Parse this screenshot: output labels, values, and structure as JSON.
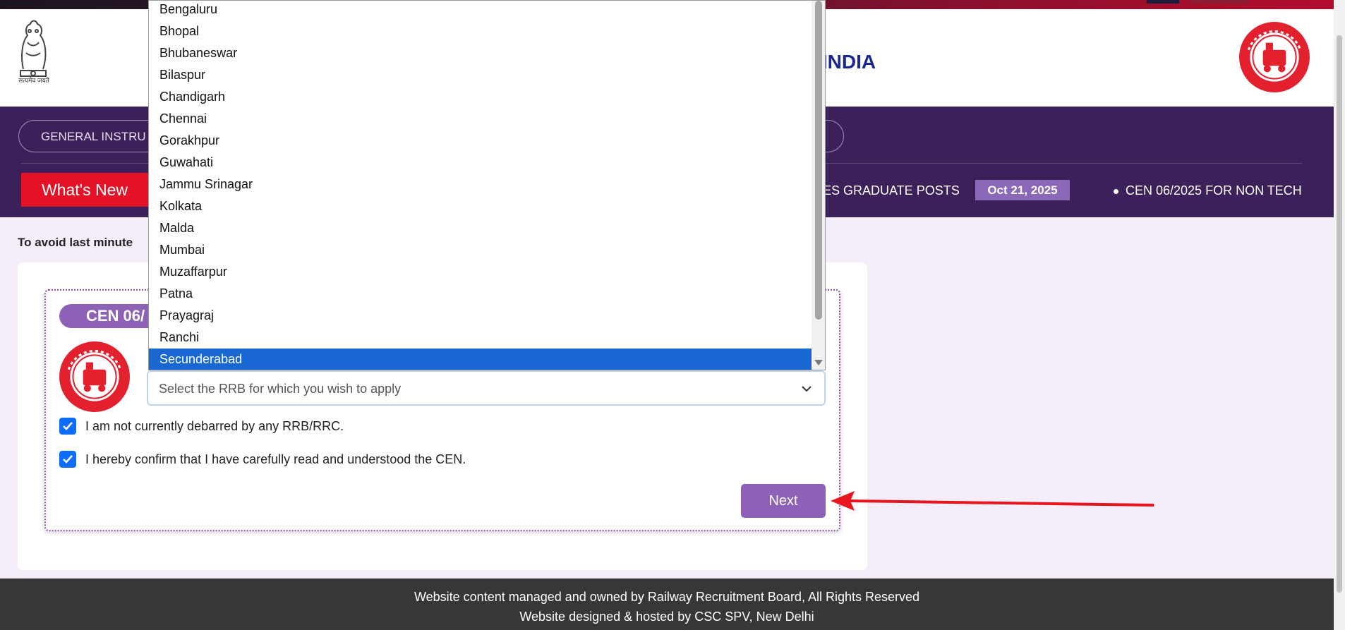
{
  "header": {
    "title": "F INDIA",
    "emblem_caption": "सत्यमेव जयते"
  },
  "nav": {
    "first_item": "GENERAL INSTRU"
  },
  "ticker": {
    "label": "What's New",
    "item1_text": "RIES GRADUATE POSTS",
    "item1_date": "Oct 21, 2025",
    "item2_text": "CEN 06/2025 FOR NON TECH"
  },
  "notice": "To avoid last minute",
  "form": {
    "badge": "CEN 06/",
    "select_placeholder": "Select the RRB for which you wish to apply",
    "checkbox1_label": "I am not currently debarred by any RRB/RRC.",
    "checkbox2_label": "I hereby confirm that I have carefully read and understood the CEN.",
    "checkbox1_checked": true,
    "checkbox2_checked": true,
    "next_label": "Next"
  },
  "dropdown": {
    "options": [
      "Bengaluru",
      "Bhopal",
      "Bhubaneswar",
      "Bilaspur",
      "Chandigarh",
      "Chennai",
      "Gorakhpur",
      "Guwahati",
      "Jammu Srinagar",
      "Kolkata",
      "Malda",
      "Mumbai",
      "Muzaffarpur",
      "Patna",
      "Prayagraj",
      "Ranchi",
      "Secunderabad"
    ],
    "highlighted": "Secunderabad"
  },
  "footer": {
    "line1": "Website content managed and owned by Railway Recruitment Board, All Rights Reserved",
    "line2": "Website designed & hosted by CSC SPV, New Delhi"
  },
  "colors": {
    "nav_bg": "#3b2059",
    "accent_purple": "#8d62b6",
    "whats_new_red": "#e51126",
    "title_blue": "#1a2793",
    "selection_blue": "#1967d2",
    "footer_bg": "#373737",
    "arrow_red": "#e8141e"
  }
}
